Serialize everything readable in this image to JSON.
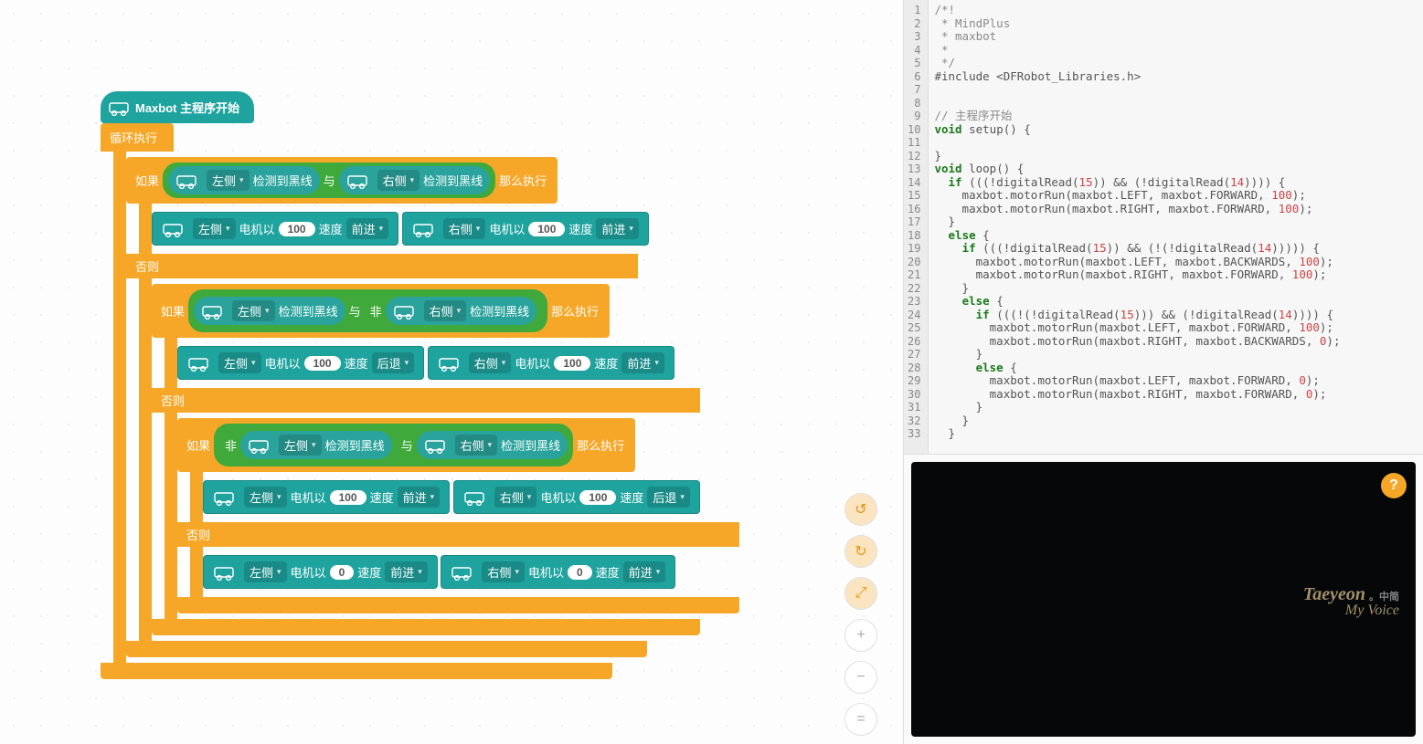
{
  "hat": {
    "label": "Maxbot 主程序开始"
  },
  "loop": {
    "label": "循环执行"
  },
  "if": {
    "if_label": "如果",
    "then_label": "那么执行",
    "else_label": "否则"
  },
  "bool": {
    "and": "与",
    "not": "非",
    "detect": "检测到黑线",
    "left": "左侧",
    "right": "右侧"
  },
  "motor": {
    "left": "左侧",
    "right": "右侧",
    "prefix": "电机以",
    "speed_label": "速度",
    "forward": "前进",
    "backward": "后退",
    "s100": "100",
    "s0": "0"
  },
  "code_lines": [
    "/*!",
    " * MindPlus",
    " * maxbot",
    " *",
    " */",
    "#include <DFRobot_Libraries.h>",
    "",
    "",
    "// 主程序开始",
    "void setup() {",
    "",
    "}",
    "void loop() {",
    "  if (((!digitalRead(15)) && (!digitalRead(14)))) {",
    "    maxbot.motorRun(maxbot.LEFT, maxbot.FORWARD, 100);",
    "    maxbot.motorRun(maxbot.RIGHT, maxbot.FORWARD, 100);",
    "  }",
    "  else {",
    "    if (((!digitalRead(15)) && (!(!digitalRead(14))))) {",
    "      maxbot.motorRun(maxbot.LEFT, maxbot.BACKWARDS, 100);",
    "      maxbot.motorRun(maxbot.RIGHT, maxbot.FORWARD, 100);",
    "    }",
    "    else {",
    "      if (((!(!digitalRead(15))) && (!digitalRead(14)))) {",
    "        maxbot.motorRun(maxbot.LEFT, maxbot.FORWARD, 100);",
    "        maxbot.motorRun(maxbot.RIGHT, maxbot.BACKWARDS, 0);",
    "      }",
    "      else {",
    "        maxbot.motorRun(maxbot.LEFT, maxbot.FORWARD, 0);",
    "        maxbot.motorRun(maxbot.RIGHT, maxbot.FORWARD, 0);",
    "      }",
    "    }",
    "  }"
  ],
  "watermark": {
    "l1": "Taeyeon",
    "l2": "My Voice",
    "cn": "。中简"
  },
  "help": "?",
  "actions": {
    "undo": "↺",
    "redo": "↻",
    "crop": "⤢",
    "zoom_in": "+",
    "zoom_out": "−",
    "center": "="
  }
}
